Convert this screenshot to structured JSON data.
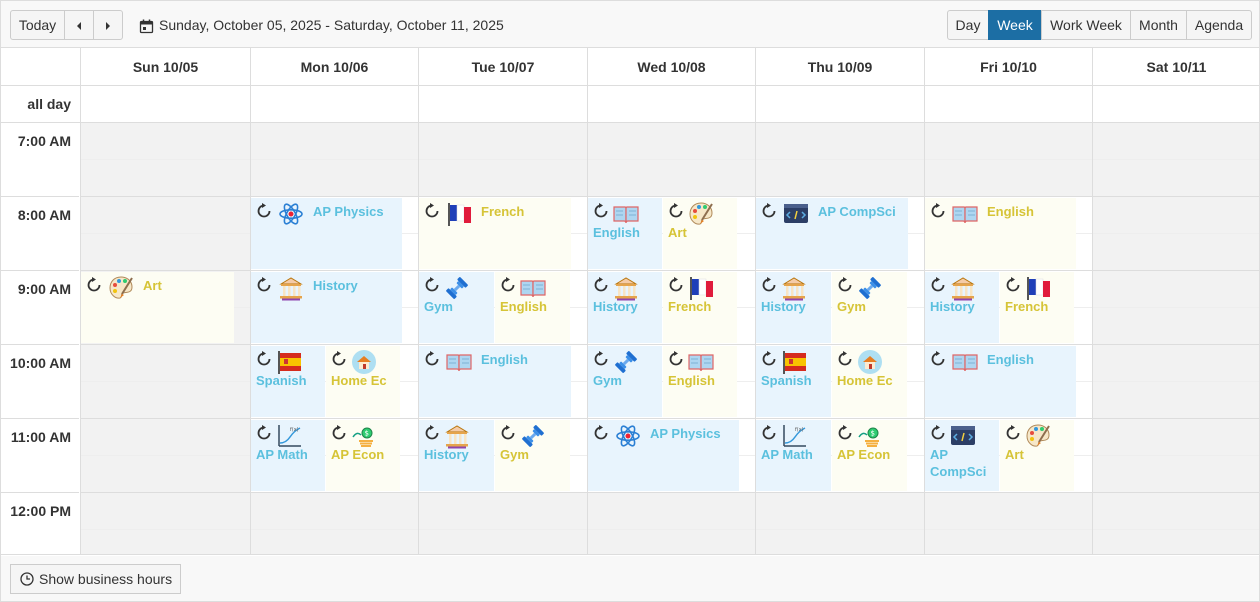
{
  "toolbar": {
    "today_label": "Today",
    "date_range": "Sunday, October 05, 2025 - Saturday, October 11, 2025",
    "views": [
      {
        "label": "Day",
        "selected": false
      },
      {
        "label": "Week",
        "selected": true
      },
      {
        "label": "Work Week",
        "selected": false
      },
      {
        "label": "Month",
        "selected": false
      },
      {
        "label": "Agenda",
        "selected": false
      }
    ]
  },
  "days": [
    "Sun 10/05",
    "Mon 10/06",
    "Tue 10/07",
    "Wed 10/08",
    "Thu 10/09",
    "Fri 10/10",
    "Sat 10/11"
  ],
  "all_day_label": "all day",
  "times": [
    "7:00 AM",
    "8:00 AM",
    "9:00 AM",
    "10:00 AM",
    "11:00 AM",
    "12:00 PM"
  ],
  "events": [
    {
      "day": 1,
      "hour": 8,
      "lane": 0,
      "lanes": 1,
      "title": "AP Physics",
      "color": "blue",
      "icon": "atom-icon"
    },
    {
      "day": 2,
      "hour": 8,
      "lane": 0,
      "lanes": 1,
      "title": "French",
      "color": "yellow",
      "icon": "france-flag-icon"
    },
    {
      "day": 3,
      "hour": 8,
      "lane": 0,
      "lanes": 2,
      "title": "English",
      "color": "blue",
      "icon": "book-icon"
    },
    {
      "day": 3,
      "hour": 8,
      "lane": 1,
      "lanes": 2,
      "title": "Art",
      "color": "yellow",
      "icon": "palette-icon"
    },
    {
      "day": 4,
      "hour": 8,
      "lane": 0,
      "lanes": 1,
      "title": "AP CompSci",
      "color": "blue",
      "icon": "code-icon"
    },
    {
      "day": 5,
      "hour": 8,
      "lane": 0,
      "lanes": 1,
      "title": "English",
      "color": "yellow",
      "icon": "book-icon"
    },
    {
      "day": 0,
      "hour": 9,
      "lane": 0,
      "lanes": 1,
      "title": "Art",
      "color": "yellow",
      "icon": "palette-icon"
    },
    {
      "day": 1,
      "hour": 9,
      "lane": 0,
      "lanes": 1,
      "title": "History",
      "color": "blue",
      "icon": "museum-icon"
    },
    {
      "day": 2,
      "hour": 9,
      "lane": 0,
      "lanes": 2,
      "title": "Gym",
      "color": "blue",
      "icon": "dumbbell-icon"
    },
    {
      "day": 2,
      "hour": 9,
      "lane": 1,
      "lanes": 2,
      "title": "English",
      "color": "yellow",
      "icon": "book-icon"
    },
    {
      "day": 3,
      "hour": 9,
      "lane": 0,
      "lanes": 2,
      "title": "History",
      "color": "blue",
      "icon": "museum-icon"
    },
    {
      "day": 3,
      "hour": 9,
      "lane": 1,
      "lanes": 2,
      "title": "French",
      "color": "yellow",
      "icon": "france-flag-icon"
    },
    {
      "day": 4,
      "hour": 9,
      "lane": 0,
      "lanes": 2,
      "title": "History",
      "color": "blue",
      "icon": "museum-icon"
    },
    {
      "day": 4,
      "hour": 9,
      "lane": 1,
      "lanes": 2,
      "title": "Gym",
      "color": "yellow",
      "icon": "dumbbell-icon"
    },
    {
      "day": 5,
      "hour": 9,
      "lane": 0,
      "lanes": 2,
      "title": "History",
      "color": "blue",
      "icon": "museum-icon"
    },
    {
      "day": 5,
      "hour": 9,
      "lane": 1,
      "lanes": 2,
      "title": "French",
      "color": "yellow",
      "icon": "france-flag-icon"
    },
    {
      "day": 1,
      "hour": 10,
      "lane": 0,
      "lanes": 2,
      "title": "Spanish",
      "color": "blue",
      "icon": "spain-flag-icon"
    },
    {
      "day": 1,
      "hour": 10,
      "lane": 1,
      "lanes": 2,
      "title": "Home Ec",
      "color": "yellow",
      "icon": "home-icon"
    },
    {
      "day": 2,
      "hour": 10,
      "lane": 0,
      "lanes": 1,
      "title": "English",
      "color": "blue",
      "icon": "book-icon"
    },
    {
      "day": 3,
      "hour": 10,
      "lane": 0,
      "lanes": 2,
      "title": "Gym",
      "color": "blue",
      "icon": "dumbbell-icon"
    },
    {
      "day": 3,
      "hour": 10,
      "lane": 1,
      "lanes": 2,
      "title": "English",
      "color": "yellow",
      "icon": "book-icon"
    },
    {
      "day": 4,
      "hour": 10,
      "lane": 0,
      "lanes": 2,
      "title": "Spanish",
      "color": "blue",
      "icon": "spain-flag-icon"
    },
    {
      "day": 4,
      "hour": 10,
      "lane": 1,
      "lanes": 2,
      "title": "Home Ec",
      "color": "yellow",
      "icon": "home-icon"
    },
    {
      "day": 5,
      "hour": 10,
      "lane": 0,
      "lanes": 1,
      "title": "English",
      "color": "blue",
      "icon": "book-icon"
    },
    {
      "day": 1,
      "hour": 11,
      "lane": 0,
      "lanes": 2,
      "title": "AP Math",
      "color": "blue",
      "icon": "graph-icon"
    },
    {
      "day": 1,
      "hour": 11,
      "lane": 1,
      "lanes": 2,
      "title": "AP Econ",
      "color": "yellow",
      "icon": "economy-icon"
    },
    {
      "day": 2,
      "hour": 11,
      "lane": 0,
      "lanes": 2,
      "title": "History",
      "color": "blue",
      "icon": "museum-icon"
    },
    {
      "day": 2,
      "hour": 11,
      "lane": 1,
      "lanes": 2,
      "title": "Gym",
      "color": "yellow",
      "icon": "dumbbell-icon"
    },
    {
      "day": 3,
      "hour": 11,
      "lane": 0,
      "lanes": 1,
      "title": "AP Physics",
      "color": "blue",
      "icon": "atom-icon"
    },
    {
      "day": 4,
      "hour": 11,
      "lane": 0,
      "lanes": 2,
      "title": "AP Math",
      "color": "blue",
      "icon": "graph-icon"
    },
    {
      "day": 4,
      "hour": 11,
      "lane": 1,
      "lanes": 2,
      "title": "AP Econ",
      "color": "yellow",
      "icon": "economy-icon"
    },
    {
      "day": 5,
      "hour": 11,
      "lane": 0,
      "lanes": 2,
      "title": "AP CompSci",
      "color": "blue",
      "icon": "code-icon"
    },
    {
      "day": 5,
      "hour": 11,
      "lane": 1,
      "lanes": 2,
      "title": "Art",
      "color": "yellow",
      "icon": "palette-icon"
    }
  ],
  "footer": {
    "business_hours_label": "Show business hours"
  }
}
